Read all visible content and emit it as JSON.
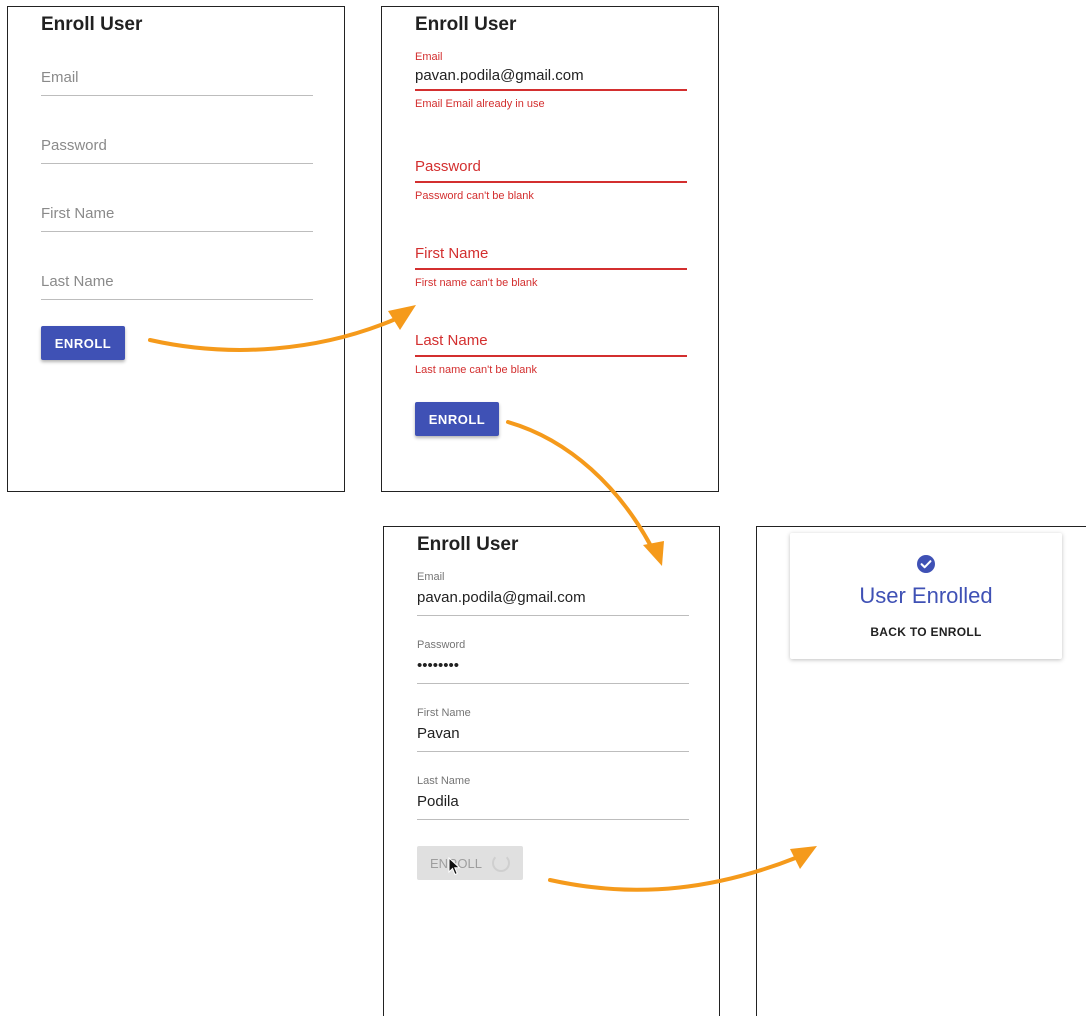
{
  "panel1": {
    "title": "Enroll User",
    "email_placeholder": "Email",
    "password_placeholder": "Password",
    "first_name_placeholder": "First Name",
    "last_name_placeholder": "Last Name",
    "button_label": "ENROLL"
  },
  "panel2": {
    "title": "Enroll User",
    "email_label": "Email",
    "email_value": "pavan.podila@gmail.com",
    "email_error": "Email Email already in use",
    "password_placeholder": "Password",
    "password_error": "Password can't be blank",
    "first_name_placeholder": "First Name",
    "first_name_error": "First name can't be blank",
    "last_name_placeholder": "Last Name",
    "last_name_error": "Last name can't be blank",
    "button_label": "ENROLL"
  },
  "panel3": {
    "title": "Enroll User",
    "email_label": "Email",
    "email_value": "pavan.podila@gmail.com",
    "password_label": "Password",
    "password_value": "••••••••",
    "first_name_label": "First Name",
    "first_name_value": "Pavan",
    "last_name_label": "Last Name",
    "last_name_value": "Podila",
    "button_label": "ENROLL"
  },
  "panel4": {
    "success_title": "User Enrolled",
    "back_label": "BACK TO ENROLL"
  },
  "colors": {
    "primary": "#3f51b5",
    "error": "#d32f2f",
    "arrow": "#f59a1b"
  },
  "icons": {
    "success": "check-circle-icon",
    "spinner": "spinner-icon",
    "cursor": "mouse-pointer-icon",
    "flow_arrow": "flow-arrow-icon"
  }
}
